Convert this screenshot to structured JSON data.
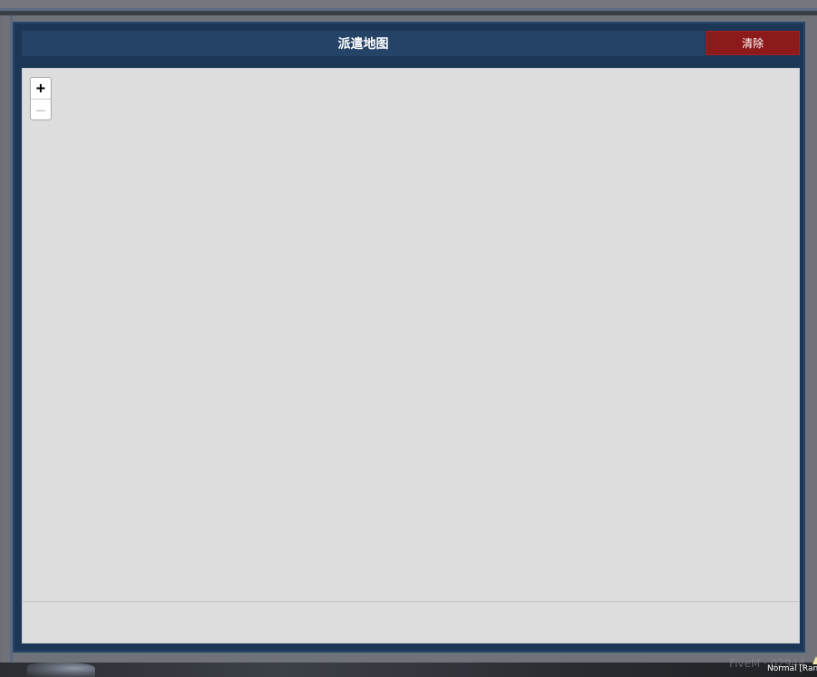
{
  "window": {
    "title": "派遣地图",
    "clear_label": "清除"
  },
  "map": {
    "zoom_in_label": "+",
    "zoom_out_label": "—"
  },
  "overlay": {
    "watermark": "FiveM · 02944",
    "status": "Normal [Ran"
  },
  "colors": {
    "window_bg": "#1c3656",
    "titlebar_bg": "#244366",
    "clear_button_bg": "#8d1a1a",
    "map_bg": "#dddddd"
  }
}
